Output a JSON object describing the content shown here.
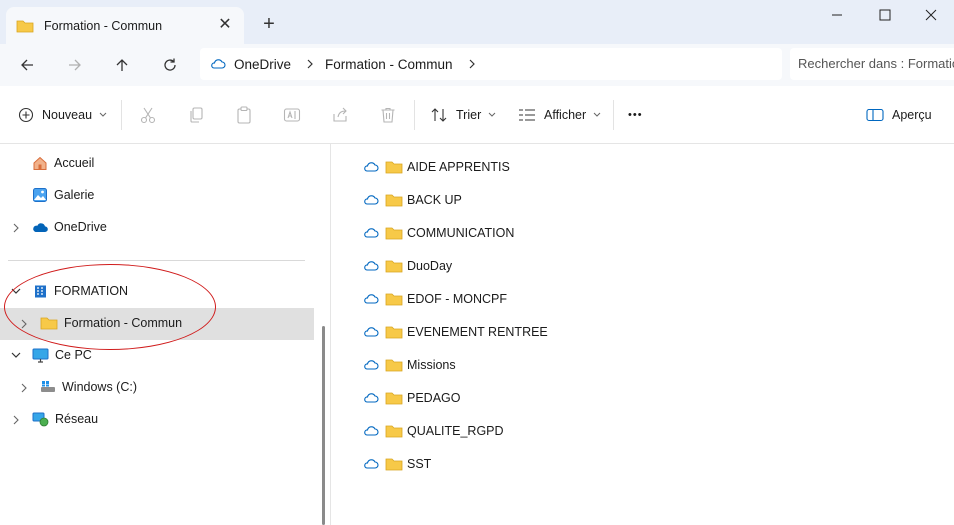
{
  "window": {
    "tab_title": "Formation - Commun",
    "tab_close": "✕",
    "new_tab": "+"
  },
  "navigation": {
    "breadcrumb": [
      "OneDrive",
      "Formation - Commun"
    ],
    "search_placeholder": "Rechercher dans : Formation - Commun"
  },
  "toolbar": {
    "new_label": "Nouveau",
    "sort_label": "Trier",
    "view_label": "Afficher",
    "more_label": "•••",
    "preview_label": "Aperçu"
  },
  "sidebar": {
    "items": [
      {
        "label": "Accueil",
        "icon": "home-icon"
      },
      {
        "label": "Galerie",
        "icon": "gallery-icon"
      },
      {
        "label": "OneDrive",
        "icon": "onedrive-icon"
      },
      {
        "label": "FORMATION",
        "icon": "building-icon"
      },
      {
        "label": "Formation - Commun",
        "icon": "folder-icon"
      },
      {
        "label": "Ce PC",
        "icon": "computer-icon"
      },
      {
        "label": "Windows (C:)",
        "icon": "drive-icon"
      },
      {
        "label": "Réseau",
        "icon": "network-icon"
      }
    ],
    "selected": "Formation - Commun"
  },
  "files": [
    "AIDE APPRENTIS",
    "BACK UP",
    "COMMUNICATION",
    "DuoDay",
    "EDOF - MONCPF",
    "EVENEMENT RENTREE",
    "Missions",
    "PEDAGO",
    "QUALITE_RGPD",
    "SST"
  ],
  "colors": {
    "accent": "#0067c0",
    "folder": "#f7c948",
    "annotation": "#d01c1c"
  }
}
